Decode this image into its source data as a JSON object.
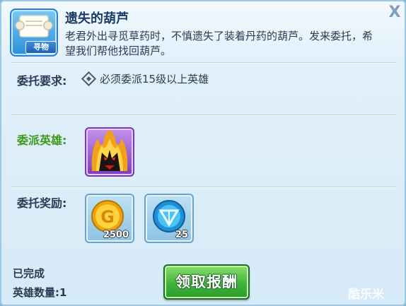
{
  "header": {
    "icon_tag": "寻物",
    "title": "遗失的葫芦",
    "description": "老君外出寻觅草药时，不慎遗失了装着丹药的葫芦。发来委托，希望我们帮他找回葫芦。",
    "close_glyph": "X"
  },
  "requirement": {
    "label": "委托要求:",
    "text": "必须委派15级以上英雄"
  },
  "assigned_hero": {
    "label": "委派英雄:"
  },
  "rewards": {
    "label": "委托奖励:",
    "items": [
      {
        "icon": "gold-coin-icon",
        "count": "2500"
      },
      {
        "icon": "blue-orb-icon",
        "count": "25"
      }
    ]
  },
  "status": {
    "completed": "已完成",
    "hero_count": "英雄数量:1"
  },
  "claim_button": "领取报酬",
  "watermark": "酷乐米",
  "colors": {
    "title": "#1b3c66",
    "hero_label": "#3c9a1c",
    "claim_button": "#3eb43a"
  }
}
